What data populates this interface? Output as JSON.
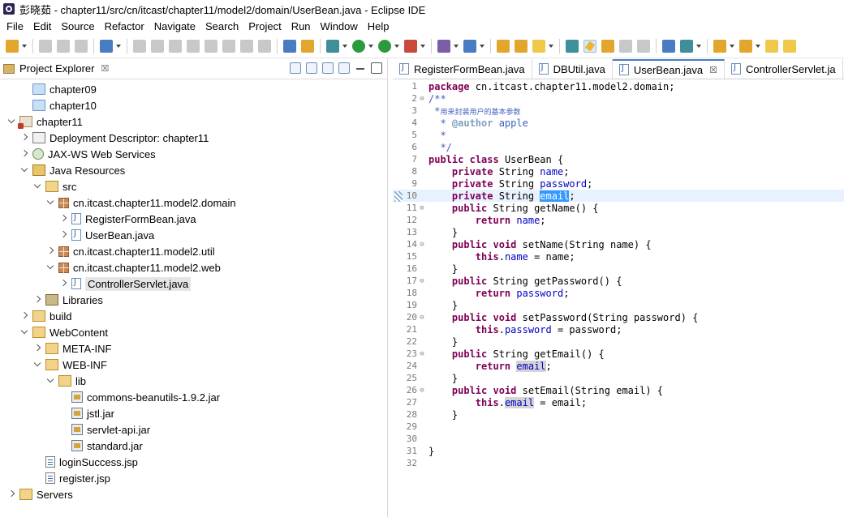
{
  "window": {
    "title": "彭晓茹 - chapter11/src/cn/itcast/chapter11/model2/domain/UserBean.java - Eclipse IDE"
  },
  "menu": [
    "File",
    "Edit",
    "Source",
    "Refactor",
    "Navigate",
    "Search",
    "Project",
    "Run",
    "Window",
    "Help"
  ],
  "left_panel": {
    "title": "Project Explorer",
    "close": "☒"
  },
  "tree": [
    {
      "label": "chapter09",
      "depth": 1,
      "twisty": "none",
      "icon": "project"
    },
    {
      "label": "chapter10",
      "depth": 1,
      "twisty": "none",
      "icon": "project"
    },
    {
      "label": "chapter11",
      "depth": 0,
      "twisty": "open",
      "icon": "webproj"
    },
    {
      "label": "Deployment Descriptor: chapter11",
      "depth": 1,
      "twisty": "closed",
      "icon": "descriptor"
    },
    {
      "label": "JAX-WS Web Services",
      "depth": 1,
      "twisty": "closed",
      "icon": "service"
    },
    {
      "label": "Java Resources",
      "depth": 1,
      "twisty": "open",
      "icon": "jres"
    },
    {
      "label": "src",
      "depth": 2,
      "twisty": "open",
      "icon": "srcfolder"
    },
    {
      "label": "cn.itcast.chapter11.model2.domain",
      "depth": 3,
      "twisty": "open",
      "icon": "package"
    },
    {
      "label": "RegisterFormBean.java",
      "depth": 4,
      "twisty": "closed",
      "icon": "java"
    },
    {
      "label": "UserBean.java",
      "depth": 4,
      "twisty": "closed",
      "icon": "java"
    },
    {
      "label": "cn.itcast.chapter11.model2.util",
      "depth": 3,
      "twisty": "closed",
      "icon": "package"
    },
    {
      "label": "cn.itcast.chapter11.model2.web",
      "depth": 3,
      "twisty": "open",
      "icon": "package"
    },
    {
      "label": "ControllerServlet.java",
      "depth": 4,
      "twisty": "closed",
      "icon": "java",
      "selected": true
    },
    {
      "label": "Libraries",
      "depth": 2,
      "twisty": "closed",
      "icon": "lib"
    },
    {
      "label": "build",
      "depth": 1,
      "twisty": "closed",
      "icon": "folder"
    },
    {
      "label": "WebContent",
      "depth": 1,
      "twisty": "open",
      "icon": "folder"
    },
    {
      "label": "META-INF",
      "depth": 2,
      "twisty": "closed",
      "icon": "folder"
    },
    {
      "label": "WEB-INF",
      "depth": 2,
      "twisty": "open",
      "icon": "folder"
    },
    {
      "label": "lib",
      "depth": 3,
      "twisty": "open",
      "icon": "folder"
    },
    {
      "label": "commons-beanutils-1.9.2.jar",
      "depth": 4,
      "twisty": "none",
      "icon": "jar"
    },
    {
      "label": "jstl.jar",
      "depth": 4,
      "twisty": "none",
      "icon": "jar"
    },
    {
      "label": "servlet-api.jar",
      "depth": 4,
      "twisty": "none",
      "icon": "jar"
    },
    {
      "label": "standard.jar",
      "depth": 4,
      "twisty": "none",
      "icon": "jar"
    },
    {
      "label": "loginSuccess.jsp",
      "depth": 2,
      "twisty": "none",
      "icon": "jsp"
    },
    {
      "label": "register.jsp",
      "depth": 2,
      "twisty": "none",
      "icon": "jsp"
    },
    {
      "label": "Servers",
      "depth": 0,
      "twisty": "closed",
      "icon": "folder"
    }
  ],
  "editor_tabs": [
    {
      "label": "RegisterFormBean.java",
      "active": false
    },
    {
      "label": "DBUtil.java",
      "active": false
    },
    {
      "label": "UserBean.java",
      "active": true,
      "close": "☒"
    },
    {
      "label": "ControllerServlet.ja",
      "active": false
    }
  ],
  "code_lines": [
    [
      [
        "kw",
        "package"
      ],
      [
        "t",
        " cn.itcast.chapter11.model2.domain;"
      ]
    ],
    [
      [
        "cmt",
        "/**"
      ]
    ],
    [
      [
        "cmt",
        " *"
      ],
      [
        "cn",
        "用来封装用户的基本参数"
      ]
    ],
    [
      [
        "cmt",
        "  * "
      ],
      [
        "tag",
        "@author"
      ],
      [
        "cmt",
        " apple"
      ]
    ],
    [
      [
        "cmt",
        "  *"
      ]
    ],
    [
      [
        "cmt",
        "  */"
      ]
    ],
    [
      [
        "kw",
        "public"
      ],
      [
        "t",
        " "
      ],
      [
        "kw",
        "class"
      ],
      [
        "t",
        " UserBean {"
      ]
    ],
    [
      [
        "t",
        "    "
      ],
      [
        "kw",
        "private"
      ],
      [
        "t",
        " String "
      ],
      [
        "field",
        "name"
      ],
      [
        "t",
        ";"
      ]
    ],
    [
      [
        "t",
        "    "
      ],
      [
        "kw",
        "private"
      ],
      [
        "t",
        " String "
      ],
      [
        "field",
        "password"
      ],
      [
        "t",
        ";"
      ]
    ],
    [
      [
        "t",
        "    "
      ],
      [
        "kw",
        "private"
      ],
      [
        "t",
        " String "
      ],
      [
        "sel",
        "email"
      ],
      [
        "t",
        ";"
      ]
    ],
    [
      [
        "t",
        "    "
      ],
      [
        "kw",
        "public"
      ],
      [
        "t",
        " String getName() {"
      ]
    ],
    [
      [
        "t",
        "        "
      ],
      [
        "kw",
        "return"
      ],
      [
        "t",
        " "
      ],
      [
        "field",
        "name"
      ],
      [
        "t",
        ";"
      ]
    ],
    [
      [
        "t",
        "    }"
      ]
    ],
    [
      [
        "t",
        "    "
      ],
      [
        "kw",
        "public"
      ],
      [
        "t",
        " "
      ],
      [
        "kw",
        "void"
      ],
      [
        "t",
        " setName(String name) {"
      ]
    ],
    [
      [
        "t",
        "        "
      ],
      [
        "kw",
        "this"
      ],
      [
        "t",
        "."
      ],
      [
        "field",
        "name"
      ],
      [
        "t",
        " = name;"
      ]
    ],
    [
      [
        "t",
        "    }"
      ]
    ],
    [
      [
        "t",
        "    "
      ],
      [
        "kw",
        "public"
      ],
      [
        "t",
        " String getPassword() {"
      ]
    ],
    [
      [
        "t",
        "        "
      ],
      [
        "kw",
        "return"
      ],
      [
        "t",
        " "
      ],
      [
        "field",
        "password"
      ],
      [
        "t",
        ";"
      ]
    ],
    [
      [
        "t",
        "    }"
      ]
    ],
    [
      [
        "t",
        "    "
      ],
      [
        "kw",
        "public"
      ],
      [
        "t",
        " "
      ],
      [
        "kw",
        "void"
      ],
      [
        "t",
        " setPassword(String password) {"
      ]
    ],
    [
      [
        "t",
        "        "
      ],
      [
        "kw",
        "this"
      ],
      [
        "t",
        "."
      ],
      [
        "field",
        "password"
      ],
      [
        "t",
        " = password;"
      ]
    ],
    [
      [
        "t",
        "    }"
      ]
    ],
    [
      [
        "t",
        "    "
      ],
      [
        "kw",
        "public"
      ],
      [
        "t",
        " String getEmail() {"
      ]
    ],
    [
      [
        "t",
        "        "
      ],
      [
        "kw",
        "return"
      ],
      [
        "t",
        " "
      ],
      [
        "hlfield",
        "email"
      ],
      [
        "t",
        ";"
      ]
    ],
    [
      [
        "t",
        "    }"
      ]
    ],
    [
      [
        "t",
        "    "
      ],
      [
        "kw",
        "public"
      ],
      [
        "t",
        " "
      ],
      [
        "kw",
        "void"
      ],
      [
        "t",
        " setEmail(String email) {"
      ]
    ],
    [
      [
        "t",
        "        "
      ],
      [
        "kw",
        "this"
      ],
      [
        "t",
        "."
      ],
      [
        "hlfield",
        "email"
      ],
      [
        "t",
        " = email;"
      ]
    ],
    [
      [
        "t",
        "    }"
      ]
    ],
    [
      [
        "t",
        ""
      ]
    ],
    [
      [
        "t",
        ""
      ]
    ],
    [
      [
        "t",
        "}"
      ]
    ],
    [
      [
        "t",
        ""
      ]
    ]
  ],
  "fold_lines": [
    2,
    11,
    14,
    17,
    20,
    23,
    26
  ],
  "current_line": 10
}
